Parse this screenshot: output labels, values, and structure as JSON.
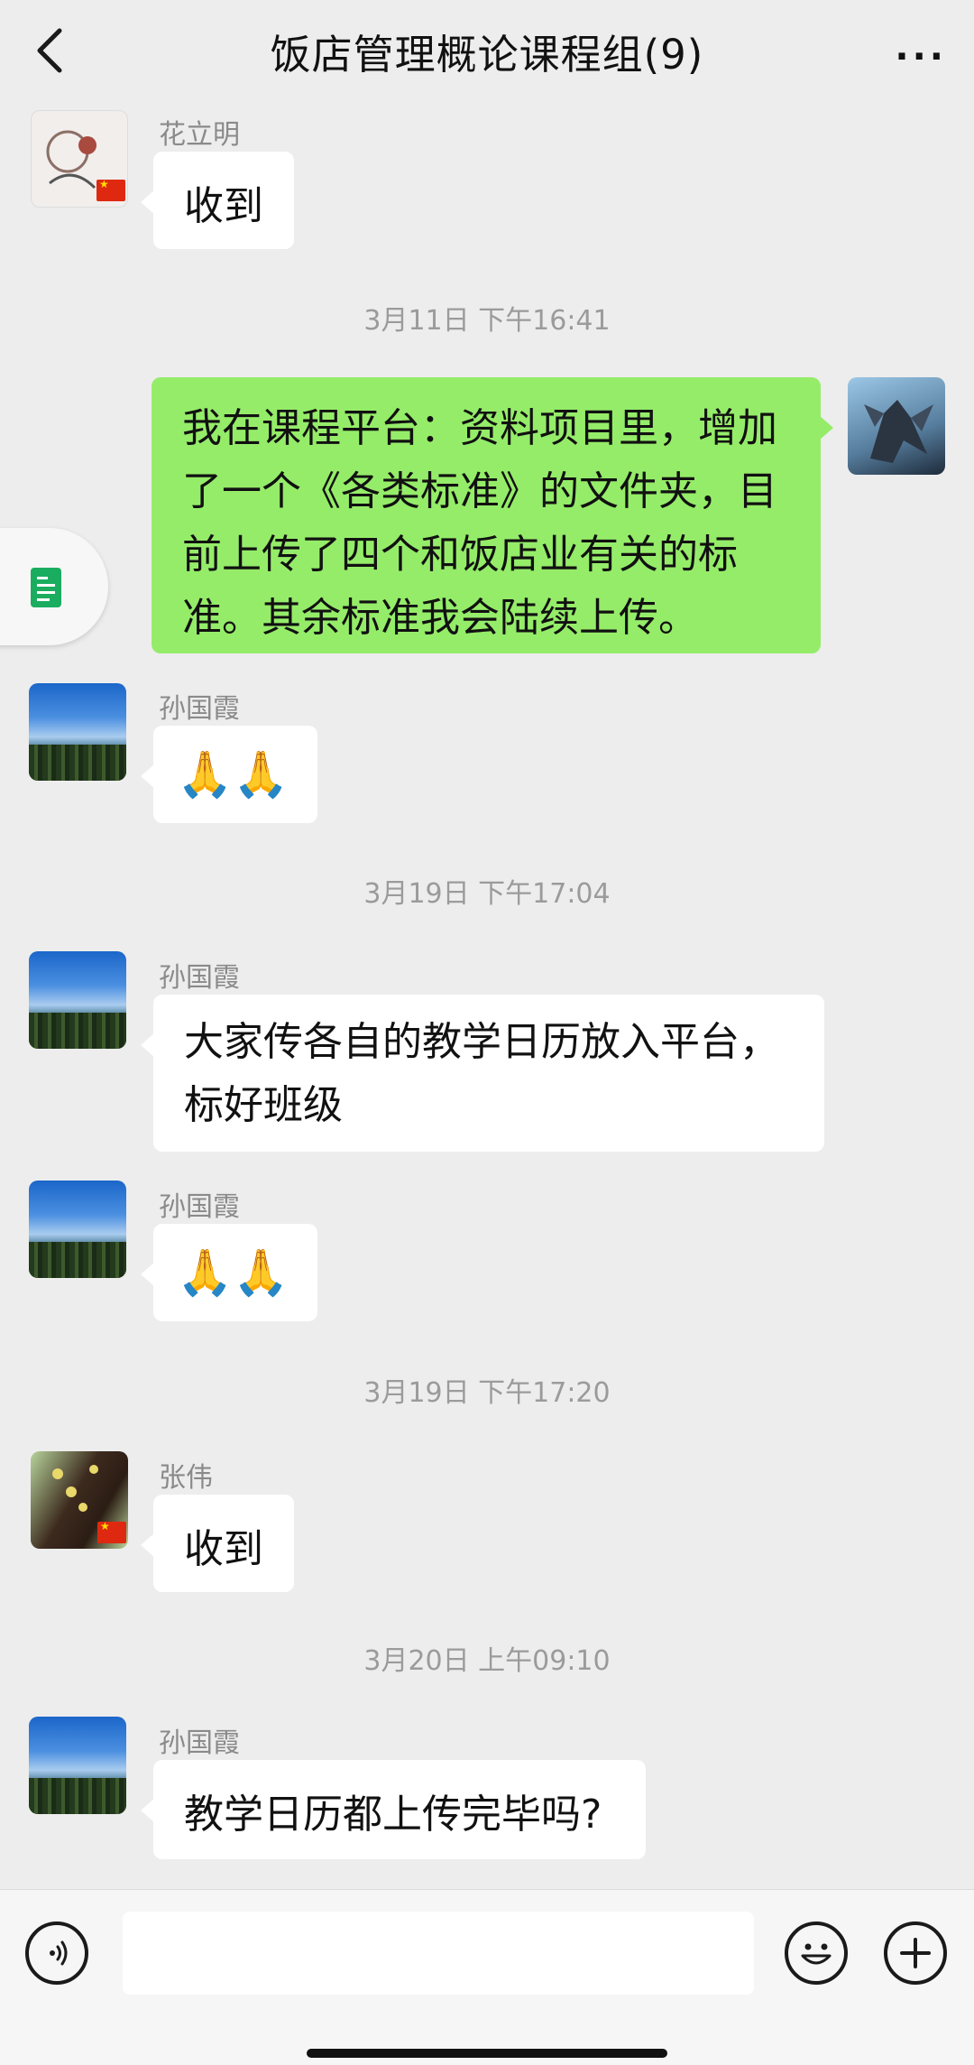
{
  "header": {
    "title": "饭店管理概论课程组(9)",
    "more": "···"
  },
  "messages": [
    {
      "name": "花立明",
      "text": "收到"
    },
    {
      "time": "3月11日 下午16:41"
    },
    {
      "text": "我在课程平台：资料项目里，增加了一个《各类标准》的文件夹，目前上传了四个和饭店业有关的标准。其余标准我会陆续上传。"
    },
    {
      "name": "孙国霞",
      "text": "🙏🙏"
    },
    {
      "time": "3月19日 下午17:04"
    },
    {
      "name": "孙国霞",
      "text": "大家传各自的教学日历放入平台，标好班级"
    },
    {
      "name": "孙国霞",
      "text": "🙏🙏"
    },
    {
      "time": "3月19日 下午17:20"
    },
    {
      "name": "张伟",
      "text": "收到"
    },
    {
      "time": "3月20日 上午09:10"
    },
    {
      "name": "孙国霞",
      "text": "教学日历都上传完毕吗?"
    }
  ],
  "colors": {
    "background": "#ededed",
    "self_bubble": "#95ec69",
    "other_bubble": "#ffffff"
  }
}
